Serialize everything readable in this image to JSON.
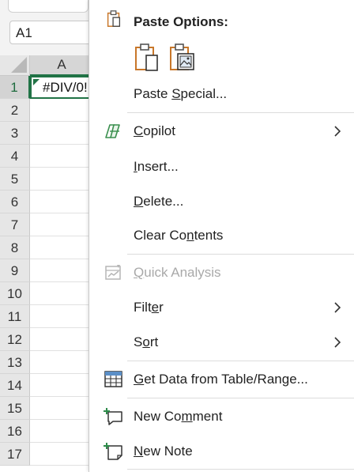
{
  "namebox": {
    "value": "A1"
  },
  "grid": {
    "column_header": "A",
    "row_numbers": [
      "1",
      "2",
      "3",
      "4",
      "5",
      "6",
      "7",
      "8",
      "9",
      "10",
      "11",
      "12",
      "13",
      "14",
      "15",
      "16",
      "17"
    ],
    "active_cell_value": "#DIV/0!"
  },
  "menu": {
    "paste_options_title": "Paste Options:",
    "paste_special": {
      "pre": "Paste ",
      "key": "S",
      "post": "pecial..."
    },
    "copilot": {
      "pre": "",
      "key": "C",
      "post": "opilot"
    },
    "insert": {
      "pre": "",
      "key": "I",
      "post": "nsert..."
    },
    "delete": {
      "pre": "",
      "key": "D",
      "post": "elete..."
    },
    "clear_contents": {
      "pre": "Clear Co",
      "key": "n",
      "post": "tents"
    },
    "quick_analysis": {
      "pre": "",
      "key": "Q",
      "post": "uick Analysis"
    },
    "filter": {
      "pre": "Filt",
      "key": "e",
      "post": "r"
    },
    "sort": {
      "pre": "S",
      "key": "o",
      "post": "rt"
    },
    "get_data": {
      "pre": "",
      "key": "G",
      "post": "et Data from Table/Range..."
    },
    "new_comment": {
      "pre": "New Co",
      "key": "m",
      "post": "ment"
    },
    "new_note": {
      "pre": "",
      "key": "N",
      "post": "ew Note"
    }
  },
  "colors": {
    "excel_green": "#217346",
    "clipboard_orange": "#c8772a",
    "disabled_text": "#a9a9a9"
  }
}
